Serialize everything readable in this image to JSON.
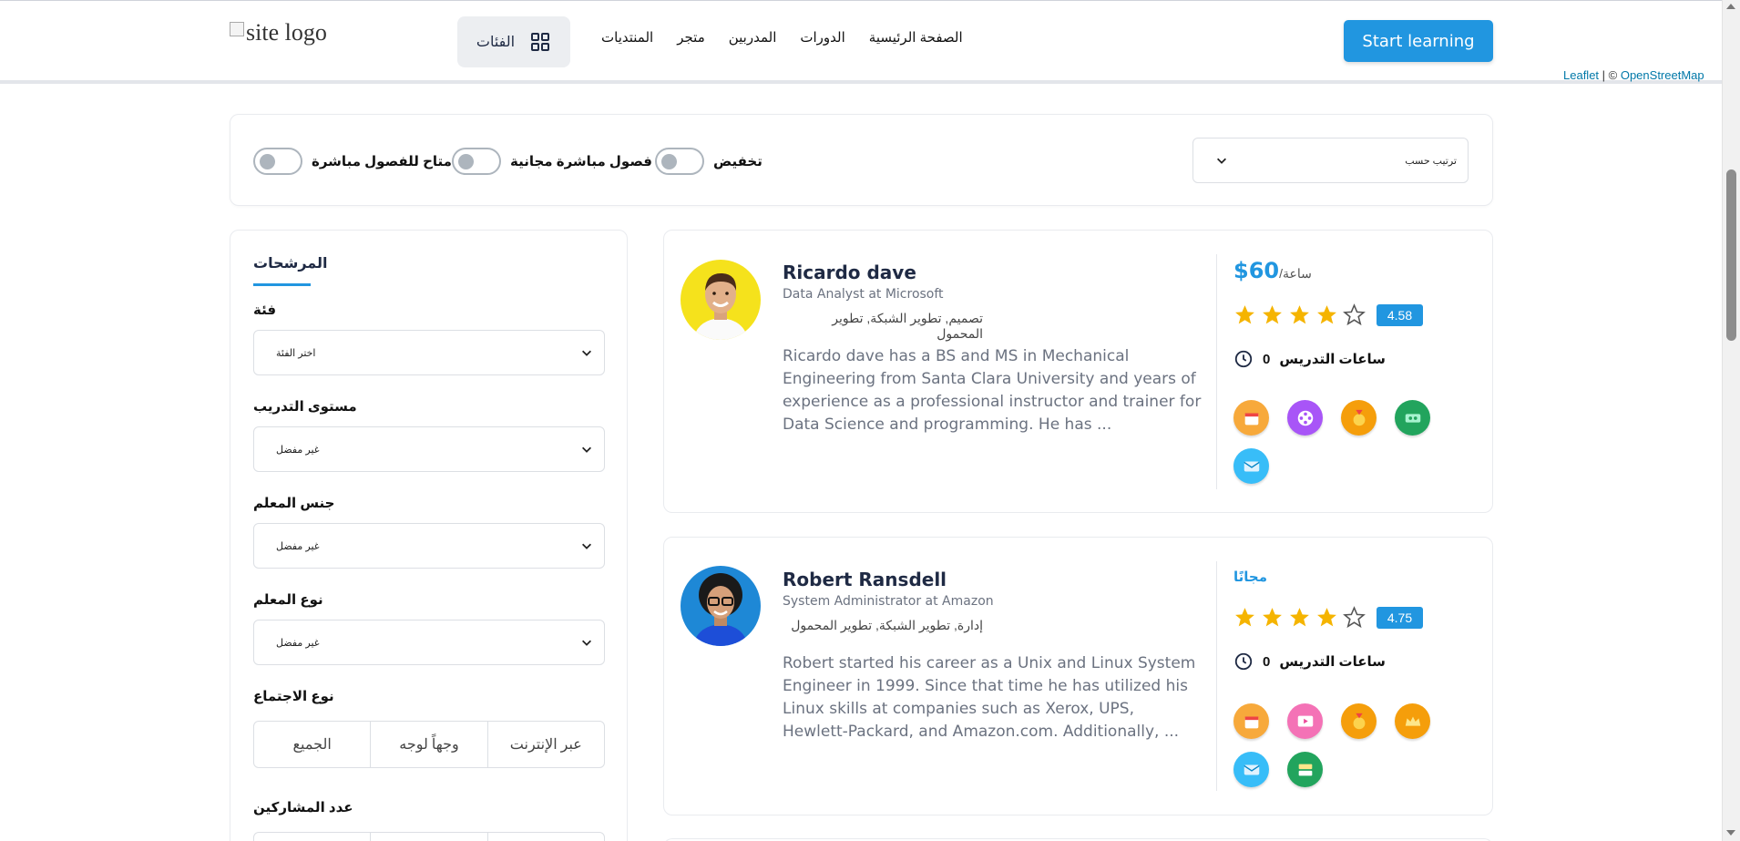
{
  "header": {
    "logo_alt": "site logo",
    "categories_label": "الفئات",
    "nav": [
      "الصفحة الرئيسية",
      "الدورات",
      "المدربين",
      "متجر",
      "المنتديات"
    ],
    "cta_label": "Start learning",
    "attribution": {
      "leaflet": "Leaflet",
      "sep": " | © ",
      "osm": "OpenStreetMap"
    }
  },
  "filterbar": {
    "toggles": [
      {
        "label": "متاح للفصول مباشرة",
        "on": false
      },
      {
        "label": "فصول مباشرة مجانية",
        "on": false
      },
      {
        "label": "تخفيض",
        "on": false
      }
    ],
    "sort_placeholder": "ترتيب حسب"
  },
  "sidebar": {
    "title": "المرشحات",
    "category_label": "فئة",
    "category_value": "اختر الفئة",
    "level_label": "مستوى التدريب",
    "level_value": "غير مفضل",
    "gender_label": "جنس المعلم",
    "gender_value": "غير مفضل",
    "type_label": "نوع المعلم",
    "type_value": "غير مفضل",
    "meeting_label": "نوع الاجتماع",
    "meeting_options": [
      "الجميع",
      "وجهاً لوجه",
      "عبر الإنترنت"
    ],
    "participants_label": "عدد المشاركين"
  },
  "instructors": [
    {
      "name": "Ricardo dave",
      "job": "Data Analyst at Microsoft",
      "categories": "تصميم, تطوير الشبكة, تطوير المحمول",
      "bio": "Ricardo dave has a BS and MS in Mechanical Engineering from Santa Clara University and years of experience as a professional instructor and trainer for Data Science and programming. He has ...",
      "price": "$60",
      "price_unit": "/ساعة",
      "stars": 4,
      "rating": "4.58",
      "hours_label": "ساعات التدريس",
      "hours_value": "0",
      "badges": [
        {
          "icon": "calendar-badge-icon",
          "color": "#f7a93b"
        },
        {
          "icon": "film-reel-badge-icon",
          "color": "#a855f7"
        },
        {
          "icon": "medal-badge-icon",
          "color": "#f59e0b"
        },
        {
          "icon": "ticket-badge-icon",
          "color": "#22a45d"
        },
        {
          "icon": "mail-badge-icon",
          "color": "#38bdf8"
        }
      ]
    },
    {
      "name": "Robert Ransdell",
      "job": "System Administrator at Amazon",
      "categories": "إدارة, تطوير الشبكة, تطوير المحمول",
      "bio": "Robert started his career as a Unix and Linux System Engineer in 1999. Since that time he has utilized his Linux skills at companies such as Xerox, UPS, Hewlett-Packard, and Amazon.com. Additionally, ...",
      "price_free": "مجانًا",
      "stars": 4,
      "rating": "4.75",
      "hours_label": "ساعات التدريس",
      "hours_value": "0",
      "badges": [
        {
          "icon": "calendar-badge-icon",
          "color": "#f7a93b"
        },
        {
          "icon": "video-badge-icon",
          "color": "#f472b6"
        },
        {
          "icon": "medal-badge-icon",
          "color": "#f59e0b"
        },
        {
          "icon": "crown-badge-icon",
          "color": "#f59e0b"
        },
        {
          "icon": "mail-badge-icon",
          "color": "#38bdf8"
        },
        {
          "icon": "layers-badge-icon",
          "color": "#22a45d"
        }
      ]
    }
  ]
}
